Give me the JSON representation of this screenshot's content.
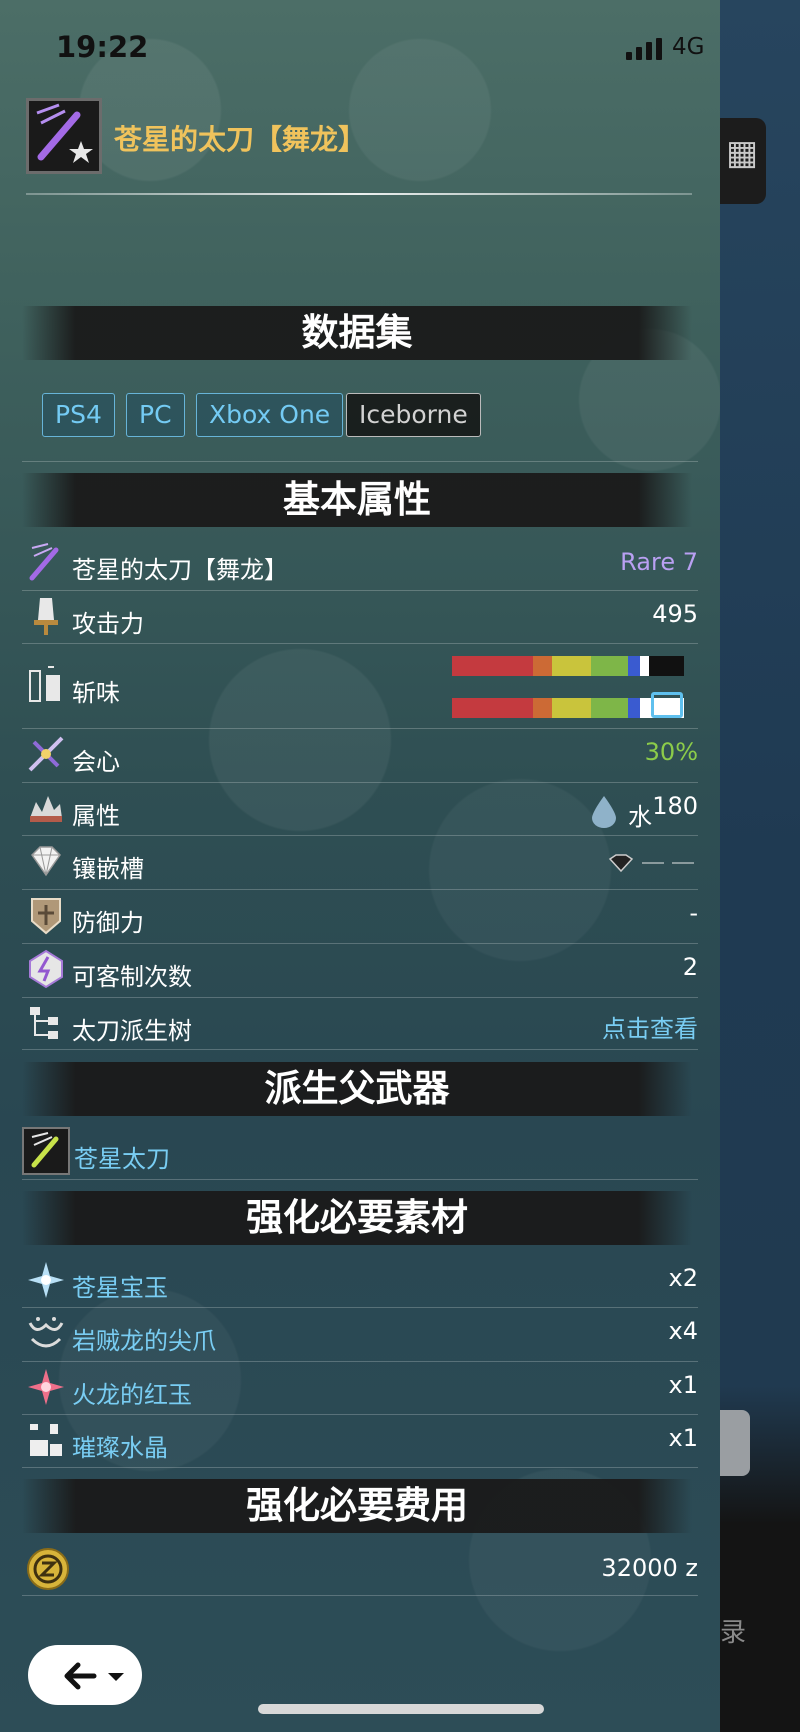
{
  "status_bar": {
    "time": "19:22",
    "network": "4G"
  },
  "header": {
    "title": "苍星的太刀【舞龙】"
  },
  "sections": {
    "dataset": "数据集",
    "basic": "基本属性",
    "parent": "派生父武器",
    "materials": "强化必要素材",
    "cost": "强化必要费用"
  },
  "platforms": [
    "PS4",
    "PC",
    "Xbox One",
    "Iceborne"
  ],
  "attributes": {
    "name": {
      "label": "苍星的太刀【舞龙】",
      "value": "Rare 7"
    },
    "attack": {
      "label": "攻击力",
      "value": "495"
    },
    "sharpness": {
      "label": "斩味"
    },
    "affinity": {
      "label": "会心",
      "value": "30%"
    },
    "element": {
      "label": "属性",
      "element_name": "水",
      "value": "180"
    },
    "slots": {
      "label": "镶嵌槽"
    },
    "defense": {
      "label": "防御力",
      "value": "-"
    },
    "customize": {
      "label": "可客制次数",
      "value": "2"
    },
    "tree": {
      "label": "太刀派生树",
      "value": "点击查看"
    }
  },
  "parent_weapon": {
    "name": "苍星太刀"
  },
  "materials": [
    {
      "name": "苍星宝玉",
      "qty": "x2"
    },
    {
      "name": "岩贼龙的尖爪",
      "qty": "x4"
    },
    {
      "name": "火龙的红玉",
      "qty": "x1"
    },
    {
      "name": "璀璨水晶",
      "qty": "x1"
    }
  ],
  "cost": {
    "value": "32000 z"
  },
  "background_app": {
    "partial_text": "录"
  },
  "colors": {
    "accent": "#74cbf4",
    "title": "#f0c35c",
    "rare": "#b9a0f2",
    "affinity": "#8ccc4a"
  },
  "sharpness_bars": [
    {
      "segments": [
        {
          "color": "#c43a3f",
          "fraction": 0.35
        },
        {
          "color": "#cc6a35",
          "fraction": 0.08
        },
        {
          "color": "#c9c43c",
          "fraction": 0.17
        },
        {
          "color": "#7eb648",
          "fraction": 0.16
        },
        {
          "color": "#3a5bd0",
          "fraction": 0.05
        },
        {
          "color": "#ffffff",
          "fraction": 0.04
        },
        {
          "color": "#111111",
          "fraction": 0.15
        }
      ]
    },
    {
      "segments": [
        {
          "color": "#c43a3f",
          "fraction": 0.35
        },
        {
          "color": "#cc6a35",
          "fraction": 0.08
        },
        {
          "color": "#c9c43c",
          "fraction": 0.17
        },
        {
          "color": "#7eb648",
          "fraction": 0.16
        },
        {
          "color": "#3a5bd0",
          "fraction": 0.05
        },
        {
          "color": "#ffffff",
          "fraction": 0.19
        }
      ]
    }
  ]
}
